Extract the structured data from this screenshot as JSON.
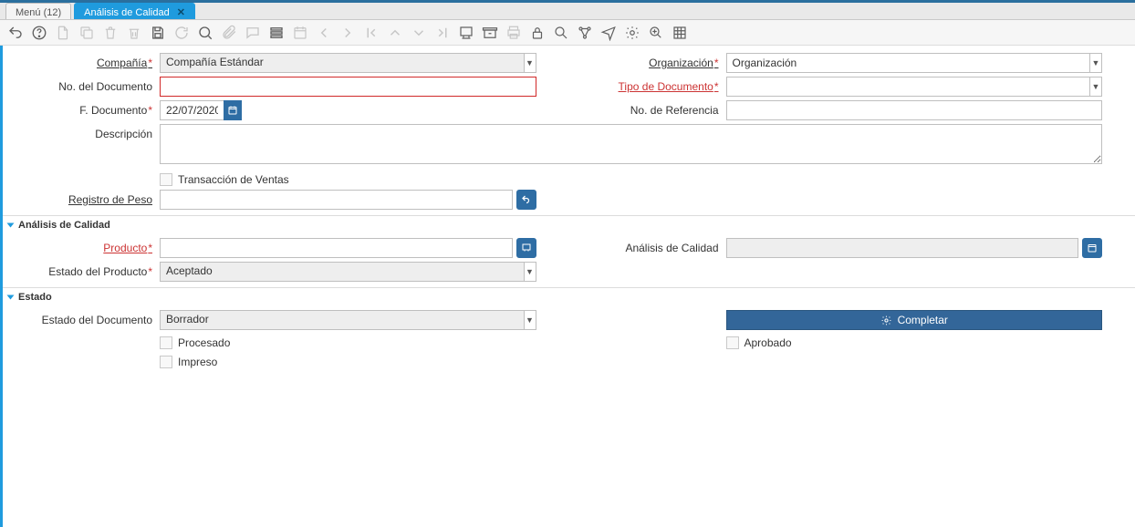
{
  "tabs": {
    "menu": "Menú (12)",
    "active": "Análisis de Calidad"
  },
  "form": {
    "labels": {
      "company": "Compañía",
      "org": "Organización",
      "docno": "No. del Documento",
      "doctype": "Tipo de Documento",
      "docdate": "F. Documento",
      "refno": "No. de Referencia",
      "description": "Descripción",
      "sales_trx": "Transacción de Ventas",
      "weight": "Registro de Peso",
      "product": "Producto",
      "quality": "Análisis de Calidad",
      "product_state": "Estado del Producto",
      "doc_state": "Estado del Documento",
      "processed": "Procesado",
      "approved": "Aprobado",
      "printed": "Impreso"
    },
    "values": {
      "company": "Compañía Estándar",
      "org": "Organización",
      "docdate": "22/07/2020",
      "product_state": "Aceptado",
      "doc_state": "Borrador"
    }
  },
  "sections": {
    "quality": "Análisis de Calidad",
    "state": "Estado"
  },
  "buttons": {
    "complete": "Completar"
  }
}
